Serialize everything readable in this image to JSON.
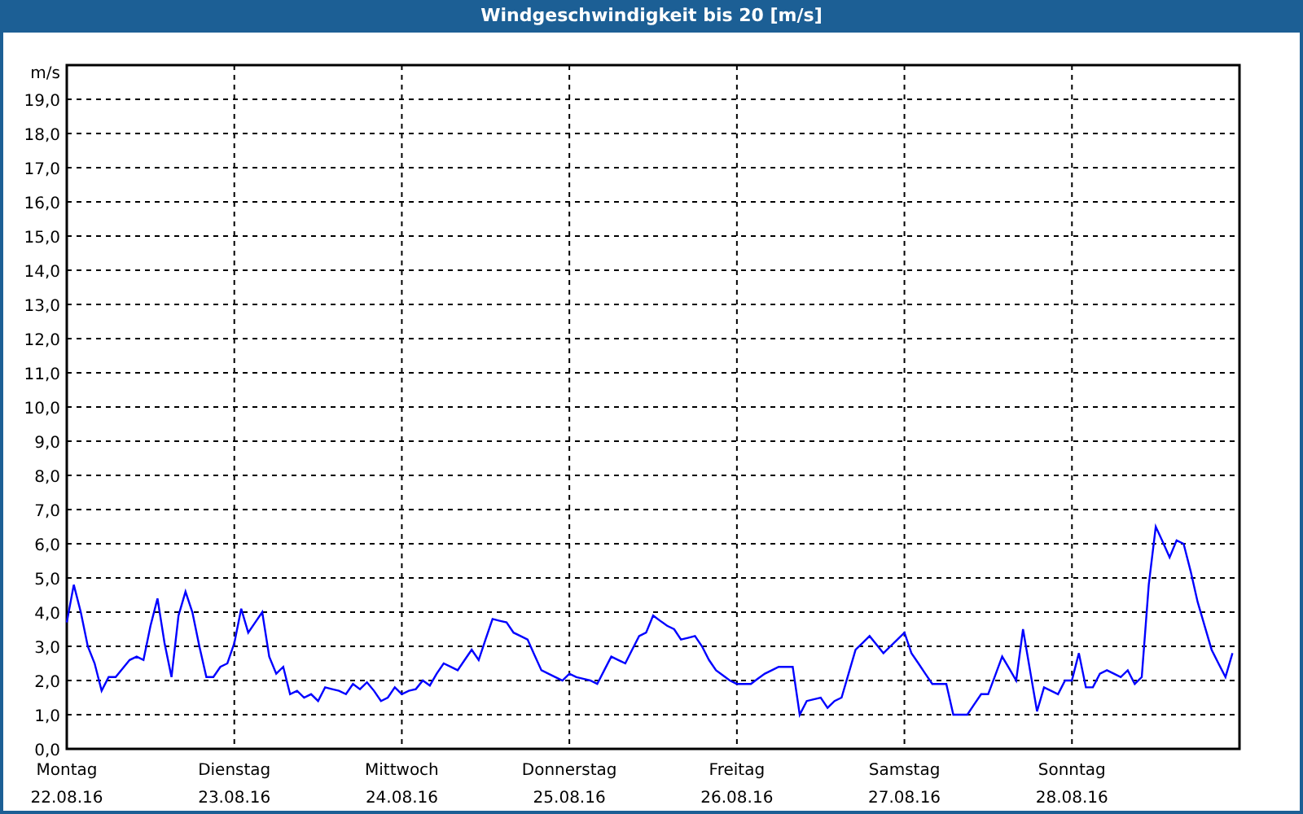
{
  "window": {
    "title": "Windgeschwindigkeit bis 20 [m/s]"
  },
  "chart": {
    "dates": [
      "22.08.16",
      "23.08.16",
      "24.08.16",
      "25.08.16",
      "26.08.16",
      "27.08.16",
      "28.08.16"
    ],
    "chart_data": {
      "type": "line",
      "ylabel": "m/s",
      "categories": [
        "Montag",
        null,
        null,
        null,
        null,
        null,
        null,
        null,
        null,
        null,
        null,
        null,
        null,
        null,
        null,
        null,
        null,
        null,
        null,
        null,
        null,
        null,
        null,
        null,
        "Dienstag",
        null,
        null,
        null,
        null,
        null,
        null,
        null,
        null,
        null,
        null,
        null,
        null,
        null,
        null,
        null,
        null,
        null,
        null,
        null,
        null,
        null,
        null,
        null,
        "Mittwoch",
        null,
        null,
        null,
        null,
        null,
        null,
        null,
        null,
        null,
        null,
        null,
        null,
        null,
        null,
        null,
        null,
        null,
        null,
        null,
        null,
        null,
        null,
        null,
        "Donnerstag",
        null,
        null,
        null,
        null,
        null,
        null,
        null,
        null,
        null,
        null,
        null,
        null,
        null,
        null,
        null,
        null,
        null,
        null,
        null,
        null,
        null,
        null,
        null,
        "Freitag",
        null,
        null,
        null,
        null,
        null,
        null,
        null,
        null,
        null,
        null,
        null,
        null,
        null,
        null,
        null,
        null,
        null,
        null,
        null,
        null,
        null,
        null,
        null,
        "Samstag",
        null,
        null,
        null,
        null,
        null,
        null,
        null,
        null,
        null,
        null,
        null,
        null,
        null,
        null,
        null,
        null,
        null,
        null,
        null,
        null,
        null,
        null,
        null,
        "Sonntag",
        null,
        null,
        null,
        null,
        null,
        null,
        null,
        null,
        null,
        null,
        null,
        null,
        null,
        null,
        null,
        null,
        null,
        null,
        null,
        null,
        null,
        null,
        null
      ],
      "series": [
        {
          "color": "#0000ff",
          "values": [
            3.7,
            4.8,
            4.0,
            3.0,
            2.5,
            1.7,
            2.1,
            2.1,
            2.35,
            2.6,
            2.7,
            2.6,
            3.6,
            4.4,
            3.1,
            2.1,
            3.9,
            4.6,
            4.0,
            3.0,
            2.1,
            2.1,
            2.4,
            2.5,
            3.1,
            4.1,
            3.4,
            3.7,
            4.0,
            2.7,
            2.2,
            2.4,
            1.6,
            1.7,
            1.5,
            1.6,
            1.4,
            1.8,
            1.75,
            1.7,
            1.6,
            1.9,
            1.75,
            1.95,
            1.7,
            1.4,
            1.5,
            1.8,
            1.6,
            1.7,
            1.75,
            2.0,
            1.85,
            2.2,
            2.5,
            2.4,
            2.3,
            2.6,
            2.9,
            2.6,
            3.2,
            3.8,
            3.75,
            3.7,
            3.4,
            3.3,
            3.2,
            2.75,
            2.3,
            2.2,
            2.1,
            2.0,
            2.2,
            2.1,
            2.05,
            2.0,
            1.9,
            2.3,
            2.7,
            2.6,
            2.5,
            2.9,
            3.3,
            3.4,
            3.9,
            3.75,
            3.6,
            3.5,
            3.2,
            3.25,
            3.3,
            3.0,
            2.6,
            2.3,
            2.15,
            2.0,
            1.9,
            1.9,
            1.9,
            2.05,
            2.2,
            2.3,
            2.4,
            2.4,
            2.4,
            1.0,
            1.4,
            1.45,
            1.5,
            1.2,
            1.4,
            1.5,
            2.2,
            2.9,
            3.1,
            3.3,
            3.05,
            2.8,
            3.0,
            3.2,
            3.4,
            2.8,
            2.5,
            2.2,
            1.9,
            1.9,
            1.9,
            1.0,
            1.0,
            1.0,
            1.3,
            1.6,
            1.6,
            2.15,
            2.7,
            2.35,
            2.0,
            3.5,
            2.3,
            1.1,
            1.8,
            1.7,
            1.6,
            2.0,
            2.0,
            2.8,
            1.8,
            1.8,
            2.2,
            2.3,
            2.2,
            2.1,
            2.3,
            1.9,
            2.1,
            4.8,
            6.5,
            6.05,
            5.6,
            6.1,
            6.0,
            5.2,
            4.3,
            3.6,
            2.9,
            2.5,
            2.1,
            2.8
          ]
        }
      ],
      "grid": true,
      "ylim": [
        0,
        20
      ],
      "yticks": [
        {
          "value": 0,
          "label": "0,0"
        },
        {
          "value": 1,
          "label": "1,0"
        },
        {
          "value": 2,
          "label": "2,0"
        },
        {
          "value": 3,
          "label": "3,0"
        },
        {
          "value": 4,
          "label": "4,0"
        },
        {
          "value": 5,
          "label": "5,0"
        },
        {
          "value": 6,
          "label": "6,0"
        },
        {
          "value": 7,
          "label": "7,0"
        },
        {
          "value": 8,
          "label": "8,0"
        },
        {
          "value": 9,
          "label": "9,0"
        },
        {
          "value": 10,
          "label": "10,0"
        },
        {
          "value": 11,
          "label": "11,0"
        },
        {
          "value": 12,
          "label": "12,0"
        },
        {
          "value": 13,
          "label": "13,0"
        },
        {
          "value": 14,
          "label": "14,0"
        },
        {
          "value": 15,
          "label": "15,0"
        },
        {
          "value": 16,
          "label": "16,0"
        },
        {
          "value": 17,
          "label": "17,0"
        },
        {
          "value": 18,
          "label": "18,0"
        },
        {
          "value": 19,
          "label": "19,0"
        }
      ]
    }
  }
}
